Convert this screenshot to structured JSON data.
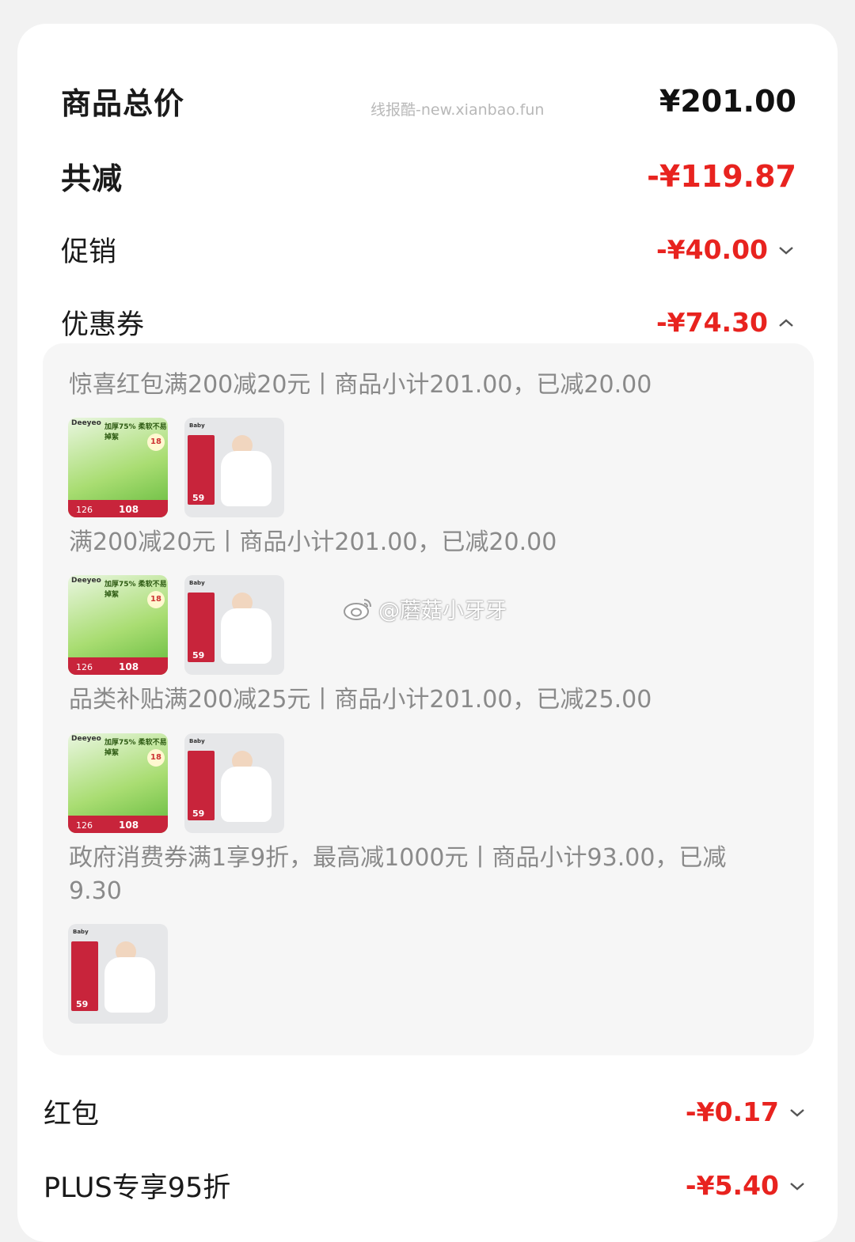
{
  "summary": {
    "total_label": "商品总价",
    "total_amount": "¥201.00",
    "reduction_label": "共减",
    "reduction_amount": "-¥119.87"
  },
  "watermark_top": "线报酷-new.xianbao.fun",
  "watermark_weibo": "@蘑菇小牙牙",
  "promo": {
    "label": "促销",
    "amount": "-¥40.00"
  },
  "coupon": {
    "label": "优惠券",
    "amount": "-¥74.30",
    "items": [
      {
        "text": "惊喜红包满200减20元丨商品小计201.00，已减20.00"
      },
      {
        "text": "满200减20元丨商品小计201.00，已减20.00"
      },
      {
        "text": "品类补贴满200减25元丨商品小计201.00，已减25.00"
      },
      {
        "text": "政府消费券满1享9折，最高减1000元丨商品小计93.00，已减9.30"
      }
    ],
    "thumb_a": {
      "brand": "Deeyeo",
      "tag": "加厚75% 柔软不易掉絮",
      "badge": "18",
      "price_old": "126",
      "price": "108"
    },
    "thumb_b": {
      "brand": "Baby",
      "num": "59"
    }
  },
  "red_packet": {
    "label": "红包",
    "amount": "-¥0.17"
  },
  "plus": {
    "label": "PLUS专享95折",
    "amount": "-¥5.40"
  },
  "colors": {
    "accent_red": "#e8231f",
    "panel_bg": "#f6f6f6"
  }
}
